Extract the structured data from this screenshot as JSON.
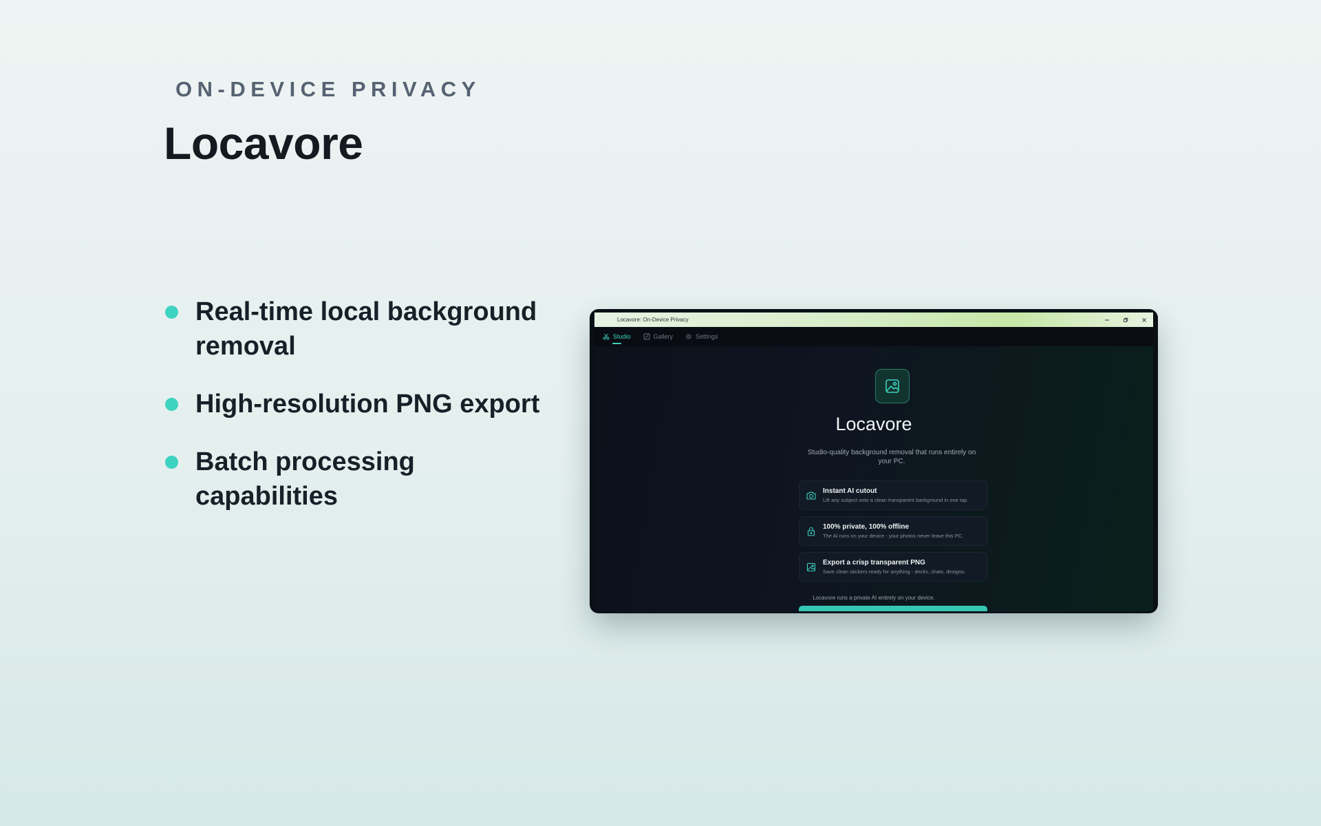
{
  "slide": {
    "eyebrow": "ON-DEVICE PRIVACY",
    "title": "Locavore",
    "features": [
      "Real-time local background removal",
      "High-resolution PNG export",
      "Batch processing capabilities"
    ]
  },
  "window": {
    "title": "Locavore: On-Device Privacy",
    "controls": [
      "minimize-icon",
      "restore-icon",
      "close-icon"
    ]
  },
  "nav": {
    "tabs": [
      {
        "label": "Studio",
        "icon": "scissors-icon",
        "active": true
      },
      {
        "label": "Gallery",
        "icon": "gallery-icon",
        "active": false
      },
      {
        "label": "Settings",
        "icon": "gear-icon",
        "active": false
      }
    ]
  },
  "hero": {
    "logo_icon": "image-icon",
    "title": "Locavore",
    "tagline": "Studio-quality background removal that runs entirely on your PC."
  },
  "cards": [
    {
      "icon": "camera-icon",
      "title": "Instant AI cutout",
      "desc": "Lift any subject onto a clean transparent background in one tap."
    },
    {
      "icon": "lock-icon",
      "title": "100% private, 100% offline",
      "desc": "The AI runs on your device - your photos never leave this PC."
    },
    {
      "icon": "image-icon",
      "title": "Export a crisp transparent PNG",
      "desc": "Save clean stickers ready for anything - decks, chats, designs."
    }
  ],
  "footer": {
    "note": "Locavore runs a private AI entirely on your device."
  },
  "colors": {
    "accent": "#3ed2c0",
    "background": "#eef4f3",
    "window_bg": "#0b1017"
  }
}
